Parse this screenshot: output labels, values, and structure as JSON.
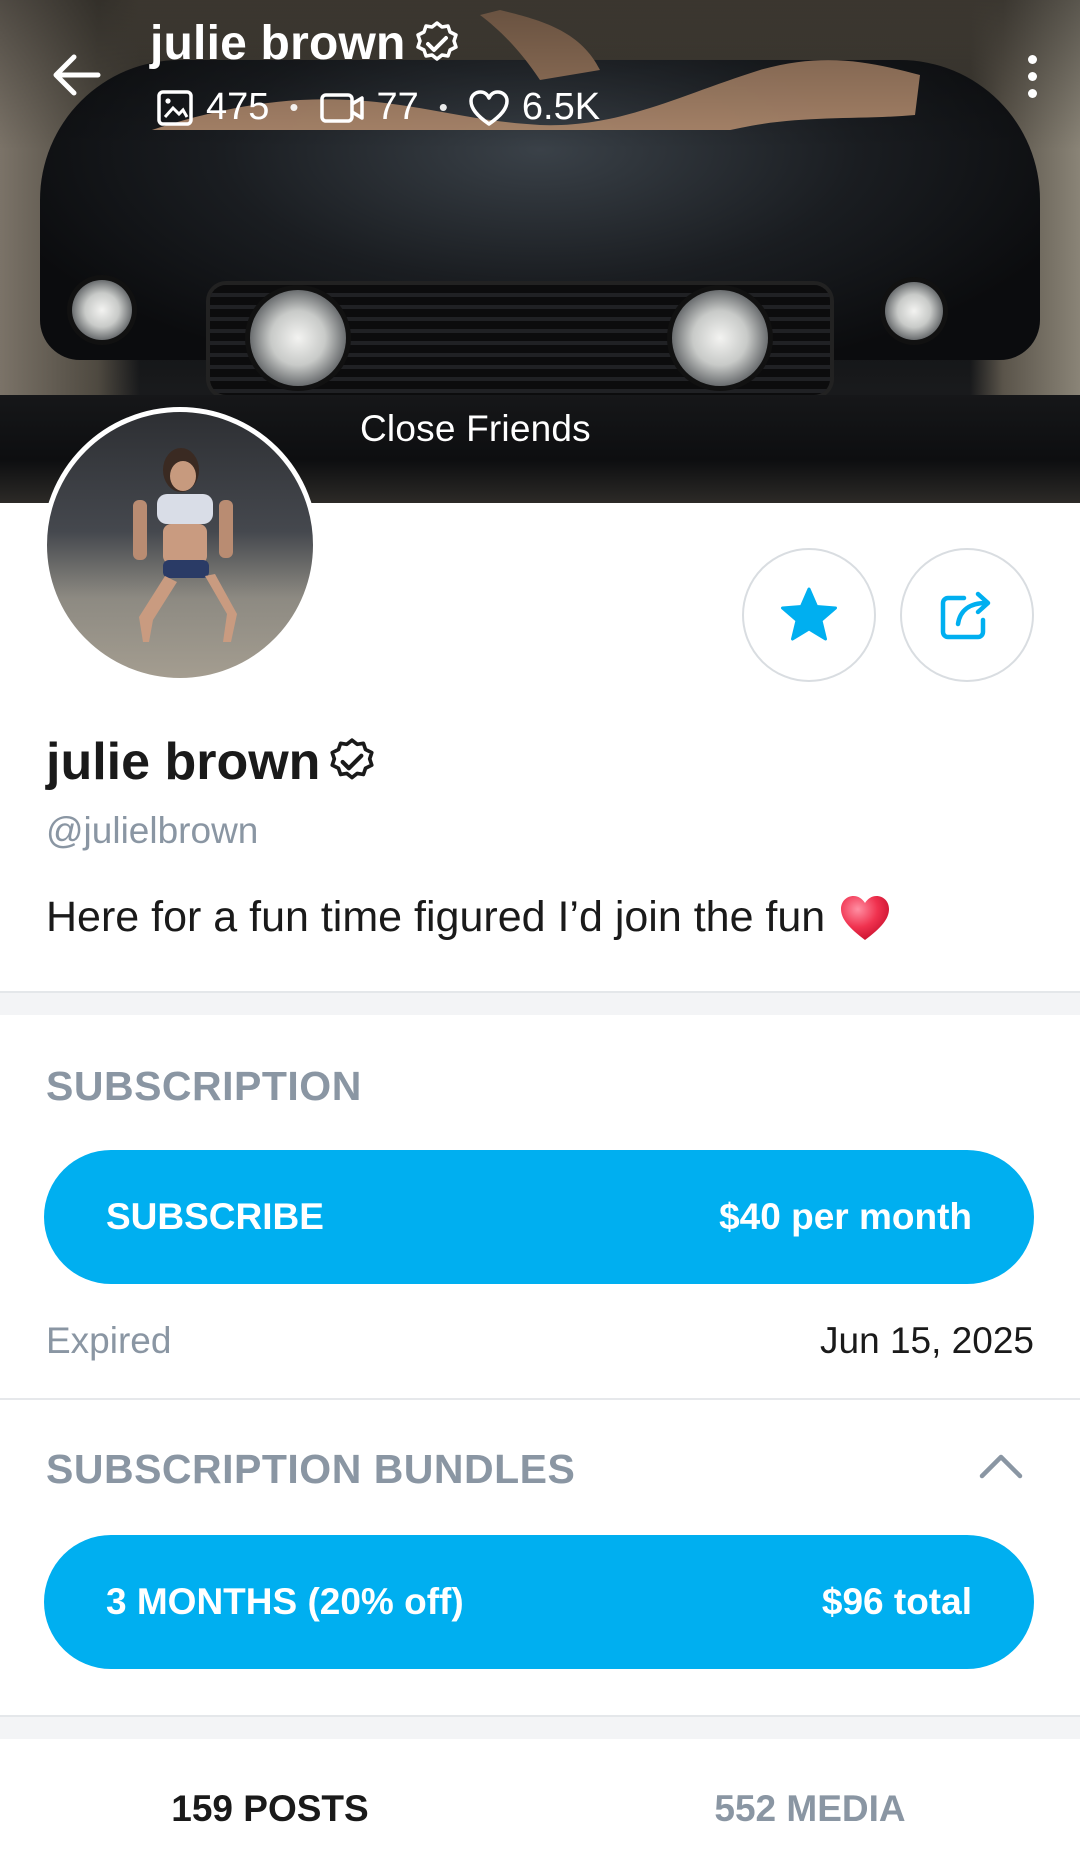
{
  "header": {
    "name": "julie brown",
    "stats": {
      "photos": "475",
      "videos": "77",
      "likes": "6.5K"
    },
    "cover_badge": "Close Friends"
  },
  "profile": {
    "name": "julie brown",
    "handle": "@julielbrown",
    "bio": "Here for a fun time figured I’d join the fun",
    "bio_emoji": "heart-emoji"
  },
  "subscription": {
    "title": "SUBSCRIPTION",
    "button_label": "SUBSCRIBE",
    "button_price": "$40 per month",
    "status_label": "Expired",
    "status_date": "Jun 15, 2025"
  },
  "bundles": {
    "title": "SUBSCRIPTION BUNDLES",
    "items": [
      {
        "label": "3 MONTHS (20% off)",
        "price": "$96 total"
      }
    ]
  },
  "tabs": [
    {
      "label": "159 POSTS",
      "active": true
    },
    {
      "label": "552 MEDIA",
      "active": false
    }
  ],
  "colors": {
    "accent": "#00aff0",
    "muted": "#8a96a3",
    "text": "#1a1a1a"
  },
  "icons": [
    "back-arrow-icon",
    "verified-icon",
    "image-icon",
    "video-icon",
    "heart-icon",
    "more-vertical-icon",
    "star-icon",
    "share-icon",
    "chevron-up-icon"
  ]
}
